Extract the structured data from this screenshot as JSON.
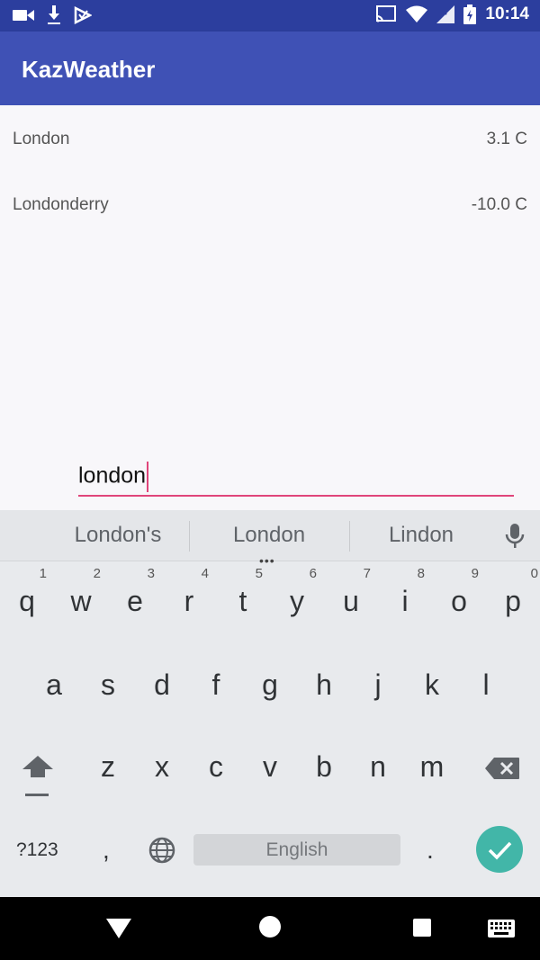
{
  "status_bar": {
    "time": "10:14",
    "left_icons": [
      "video-camera-icon",
      "download-icon",
      "play-store-icon"
    ],
    "right_icons": [
      "cast-icon",
      "wifi-icon",
      "signal-icon",
      "battery-icon"
    ]
  },
  "app_bar": {
    "title": "KazWeather"
  },
  "cities": [
    {
      "name": "London",
      "temperature": "3.1 C"
    },
    {
      "name": "Londonderry",
      "temperature": "-10.0 C"
    }
  ],
  "search": {
    "value": "london"
  },
  "keyboard": {
    "suggestions": [
      "London's",
      "London",
      "Lindon"
    ],
    "row1": [
      {
        "key": "q",
        "hint": "1"
      },
      {
        "key": "w",
        "hint": "2"
      },
      {
        "key": "e",
        "hint": "3"
      },
      {
        "key": "r",
        "hint": "4"
      },
      {
        "key": "t",
        "hint": "5"
      },
      {
        "key": "y",
        "hint": "6"
      },
      {
        "key": "u",
        "hint": "7"
      },
      {
        "key": "i",
        "hint": "8"
      },
      {
        "key": "o",
        "hint": "9"
      },
      {
        "key": "p",
        "hint": "0"
      }
    ],
    "row2": [
      "a",
      "s",
      "d",
      "f",
      "g",
      "h",
      "j",
      "k",
      "l"
    ],
    "row3": [
      "z",
      "x",
      "c",
      "v",
      "b",
      "n",
      "m"
    ],
    "symbols_label": "?123",
    "comma_label": ",",
    "period_label": ".",
    "space_label": "English",
    "accent_color": "#42b6a8"
  },
  "colors": {
    "app_bar": "#3f51b5",
    "status_bar": "#2c3e9e",
    "input_underline": "#e0457a"
  }
}
